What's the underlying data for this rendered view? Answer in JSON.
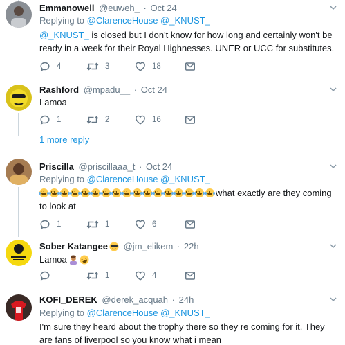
{
  "colors": {
    "accent": "#1b95e0",
    "muted": "#657786",
    "text": "#14171a",
    "divider": "#e6ecf0",
    "thread_line": "#ccd6dd"
  },
  "tweets": [
    {
      "name": "Emmanowell",
      "handle": "@euweh_",
      "dot": "·",
      "time": "Oct 24",
      "replying_prefix": "Replying to",
      "replying_to": "@ClarenceHouse @_KNUST_",
      "text_mention": "@_KNUST_",
      "text": " is closed but I don't know for how long and certainly won't be ready in a week for their Royal Highnesses. UNER or UCC for substitutes.",
      "replies": "4",
      "retweets": "3",
      "likes": "18",
      "avatar_icon": "profile-photo"
    },
    {
      "name": "Rashford",
      "handle": "@mpadu__",
      "dot": "·",
      "time": "Oct 24",
      "text": "Lamoa",
      "replies": "1",
      "retweets": "2",
      "likes": "16",
      "avatar_icon": "yellow-cartoon-avatar"
    },
    {
      "more_replies": "1 more reply"
    },
    {
      "name": "Priscilla",
      "handle": "@priscillaaa_t",
      "dot": "·",
      "time": "Oct 24",
      "replying_prefix": "Replying to",
      "replying_to": "@ClarenceHouse @_KNUST_",
      "emoji_name": "face-with-tears-of-joy",
      "emoji_count": 17,
      "text": "what exactly are they coming to look at",
      "replies": "1",
      "retweets": "1",
      "likes": "6",
      "avatar_icon": "profile-photo"
    },
    {
      "name": "Sober Katangee",
      "name_emoji": "sunglasses-face",
      "handle": "@jm_elikem",
      "dot": "·",
      "time": "22h",
      "text": "Lamoa",
      "text_emojis": [
        "person-facepalming",
        "rolling-on-floor-laughing"
      ],
      "replies": "",
      "retweets": "1",
      "likes": "4",
      "avatar_icon": "best-hint-logo"
    },
    {
      "name": "KOFI_DEREK",
      "handle": "@derek_acquah",
      "dot": "·",
      "time": "24h",
      "replying_prefix": "Replying to",
      "replying_to": "@ClarenceHouse @_KNUST_",
      "text": "I'm sure they heard about the trophy there so they re coming for it. They are fans of liverpool so you know what i mean",
      "avatar_icon": "football-jersey-photo"
    }
  ]
}
